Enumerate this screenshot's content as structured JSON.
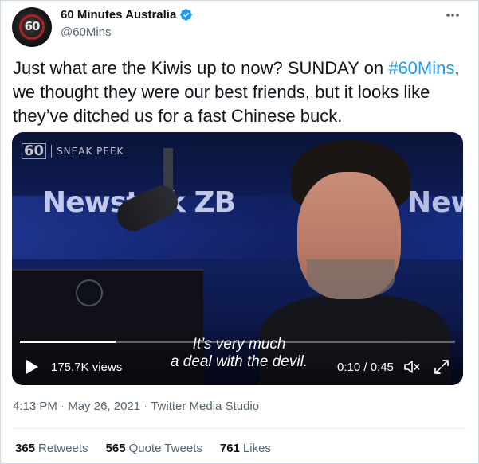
{
  "author": {
    "display_name": "60 Minutes Australia",
    "handle": "@60Mins",
    "verified": true,
    "avatar_label": "60"
  },
  "tweet": {
    "text_before": "Just what are the Kiwis up to now? SUNDAY on ",
    "hashtag": "#60Mins",
    "text_after": ", we thought they were our best friends, but it looks like they’ve ditched us for a fast Chinese buck."
  },
  "media": {
    "watermark_brand": "60",
    "watermark_label": "SNEAK PEEK",
    "background_brand_left": "Newstalk ZB",
    "background_brand_right": "News",
    "subtitle_line1": "It’s very much",
    "subtitle_line2": "a deal with the devil.",
    "views": "175.7K views",
    "time": "0:10 / 0:45",
    "progress_fraction": 0.22
  },
  "meta": {
    "time": "4:13 PM",
    "date": "May 26, 2021",
    "source": "Twitter Media Studio"
  },
  "stats": {
    "retweets_count": "365",
    "retweets_label": "Retweets",
    "quotes_count": "565",
    "quotes_label": "Quote Tweets",
    "likes_count": "761",
    "likes_label": "Likes"
  },
  "colors": {
    "accent": "#1d9bf0",
    "text_primary": "#0f1419",
    "text_secondary": "#536471",
    "border": "#cfd9de"
  },
  "icons": {
    "verified": "verified-badge-icon",
    "more": "more-options-icon",
    "play": "play-icon",
    "volume": "volume-icon",
    "fullscreen": "fullscreen-icon"
  }
}
